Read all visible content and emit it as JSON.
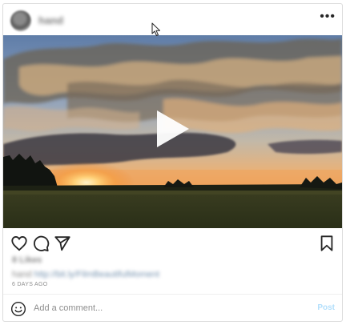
{
  "post": {
    "username": "hand",
    "more_label": "•••",
    "likes_text": "8 Likes",
    "caption": {
      "username": "hand",
      "text": "http://bit.ly/FilmBeautifulMoment"
    },
    "timestamp": "6 DAYS AGO"
  },
  "actions": {
    "like": "heart-icon",
    "comment": "comment-bubble-icon",
    "share": "send-icon",
    "save": "bookmark-icon"
  },
  "comment": {
    "placeholder": "Add a comment...",
    "post_label": "Post"
  },
  "colors": {
    "border": "#dbdbdb",
    "text": "#262626",
    "muted": "#8e8e8e",
    "post_button_disabled": "#b2dffc"
  }
}
